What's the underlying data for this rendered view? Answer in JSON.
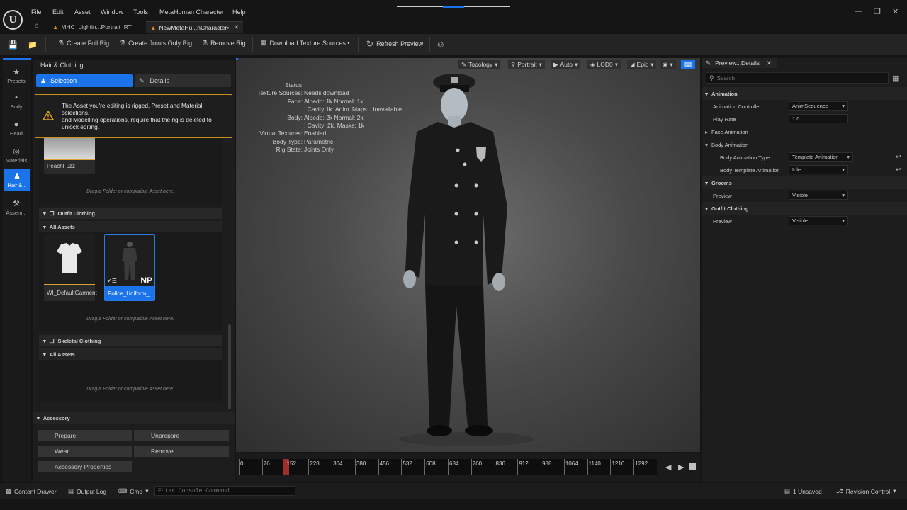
{
  "menu": [
    "File",
    "Edit",
    "Asset",
    "Window",
    "Tools",
    "MetaHuman Character",
    "Help"
  ],
  "tabs": [
    {
      "label": "MHC_Lightin...Portrait_RT"
    },
    {
      "label": "NewMetaHu...nCharacter•"
    }
  ],
  "toolbar": {
    "create_full_rig": "Create Full Rig",
    "create_joints_rig": "Create Joints Only Rig",
    "remove_rig": "Remove Rig",
    "download_textures": "Download Texture Sources •",
    "refresh_preview": "Refresh Preview"
  },
  "left_nav": [
    {
      "label": "Presets",
      "icon": "star-icon"
    },
    {
      "label": "Body",
      "icon": "body-icon"
    },
    {
      "label": "Head",
      "icon": "head-icon"
    },
    {
      "label": "Materials",
      "icon": "materials-icon"
    },
    {
      "label": "Hair &...",
      "icon": "hair-icon"
    },
    {
      "label": "Assem...",
      "icon": "hammer-icon"
    }
  ],
  "panel": {
    "title": "Hair & Clothing",
    "tab_selection": "Selection",
    "tab_details": "Details",
    "warning": "The Asset you're editing is rigged. Preset and Material selections,\nand Modelling operations, require that the rig is deleted to unlock editing.",
    "peachfuzz": "PeachFuzz",
    "drag_hint": "Drag a Folder or compatible Asset here.",
    "outfit_clothing": "Outfit Clothing",
    "all_assets": "All Assets",
    "asset1": "WI_DefaultGarment",
    "asset2": "Police_Uniform_...",
    "np_badge": "NP",
    "skeletal_clothing": "Skeletal Clothing",
    "accessory": "Accessory",
    "prepare": "Prepare",
    "unprepare": "Unprepare",
    "wear": "Wear",
    "remove": "Remove",
    "accessory_properties": "Accessory Properties"
  },
  "viewport_toolbar": {
    "topology": "Topology",
    "portrait": "Portrait",
    "auto": "Auto",
    "lod": "LOD0",
    "epic": "Epic"
  },
  "status": {
    "title": "Status",
    "rows": [
      {
        "k": "Texture Sources:",
        "v": "Needs download"
      },
      {
        "k": "Face:",
        "v": "Albedo: 1k Normal: 1k"
      },
      {
        "k": "",
        "v": ": Cavity 1k: Anim. Maps: Unavailable"
      },
      {
        "k": "Body:",
        "v": "Albedo: 2k Normal: 2k"
      },
      {
        "k": "",
        "v": ": Cavity: 2k, Masks: 1k"
      },
      {
        "k": "Virtual Textures:",
        "v": "Enabled"
      },
      {
        "k": "Body Type:",
        "v": "Parametric"
      },
      {
        "k": "Rig State:",
        "v": "Joints Only"
      }
    ]
  },
  "timeline": {
    "ticks": [
      "0",
      "76",
      "152",
      "228",
      "304",
      "380",
      "456",
      "532",
      "608",
      "684",
      "760",
      "836",
      "912",
      "988",
      "1064",
      "1140",
      "1216",
      "1292"
    ],
    "current_frame": 152,
    "max_frame": 1368
  },
  "details": {
    "tab": "Preview...Details",
    "search_placeholder": "Search",
    "animation": "Animation",
    "anim_controller": "Animation Controller",
    "anim_controller_val": "AnimSequence",
    "play_rate": "Play Rate",
    "play_rate_val": "1.0",
    "face_animation": "Face Animation",
    "body_animation": "Body Animation",
    "body_anim_type": "Body Animation Type",
    "body_anim_type_val": "Template Animation",
    "body_template_anim": "Body Template Animation",
    "body_template_anim_val": "Idle",
    "grooms": "Grooms",
    "preview": "Preview",
    "visible": "Visible",
    "outfit_clothing": "Outfit Clothing"
  },
  "bottom": {
    "content_drawer": "Content Drawer",
    "output_log": "Output Log",
    "cmd": "Cmd",
    "console_placeholder": "Enter Console Command",
    "unsaved": "1 Unsaved",
    "revision": "Revision Control"
  }
}
